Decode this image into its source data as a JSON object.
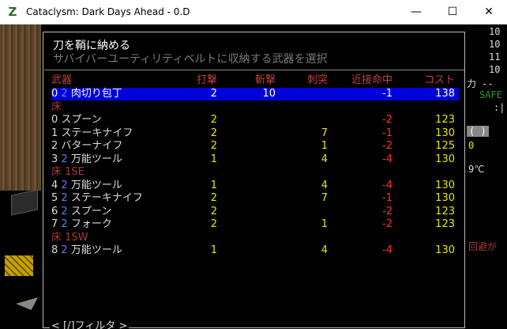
{
  "window": {
    "title": "Cataclysm: Dark Days Ahead - 0.D",
    "icon_glyph": "Z",
    "icon": "cataclysm-z-icon",
    "minimize_glyph": "—",
    "maximize_glyph": "☐",
    "close_glyph": "✕"
  },
  "dialog": {
    "title": "刀を鞘に納める",
    "subtitle": "サバイバーユーティリティベルトに収納する武器を選択",
    "headers": {
      "weapon": "武器",
      "bash": "打撃",
      "cut": "斬撃",
      "stab": "刺突",
      "to_hit": "近接命中",
      "cost": "コスト"
    },
    "rows": [
      {
        "type": "item",
        "idx": "0",
        "qty": "2",
        "name": "肉切り包丁",
        "bash": "2",
        "cut": "10",
        "stab": "",
        "hit": "-1",
        "cost": "138",
        "selected": true
      },
      {
        "type": "cat",
        "label": "床"
      },
      {
        "type": "item",
        "idx": "0",
        "qty": "",
        "name": "スプーン",
        "bash": "2",
        "cut": "",
        "stab": "",
        "hit": "-2",
        "cost": "123"
      },
      {
        "type": "item",
        "idx": "1",
        "qty": "",
        "name": "ステーキナイフ",
        "bash": "2",
        "cut": "",
        "stab": "7",
        "hit": "-1",
        "cost": "130"
      },
      {
        "type": "item",
        "idx": "2",
        "qty": "",
        "name": "バターナイフ",
        "bash": "2",
        "cut": "",
        "stab": "1",
        "hit": "-2",
        "cost": "125"
      },
      {
        "type": "item",
        "idx": "3",
        "qty": "2",
        "name": "万能ツール",
        "bash": "1",
        "cut": "",
        "stab": "4",
        "hit": "-4",
        "cost": "130"
      },
      {
        "type": "cat",
        "label": "床 1SE"
      },
      {
        "type": "item",
        "idx": "4",
        "qty": "2",
        "name": "万能ツール",
        "bash": "1",
        "cut": "",
        "stab": "4",
        "hit": "-4",
        "cost": "130"
      },
      {
        "type": "item",
        "idx": "5",
        "qty": "2",
        "name": "ステーキナイフ",
        "bash": "2",
        "cut": "",
        "stab": "7",
        "hit": "-1",
        "cost": "130"
      },
      {
        "type": "item",
        "idx": "6",
        "qty": "2",
        "name": "スプーン",
        "bash": "2",
        "cut": "",
        "stab": "",
        "hit": "-2",
        "cost": "123"
      },
      {
        "type": "item",
        "idx": "7",
        "qty": "2",
        "name": "フォーク",
        "bash": "2",
        "cut": "",
        "stab": "1",
        "hit": "-2",
        "cost": "123"
      },
      {
        "type": "cat",
        "label": "床 1SW"
      },
      {
        "type": "item",
        "idx": "8",
        "qty": "2",
        "name": "万能ツール",
        "bash": "1",
        "cut": "",
        "stab": "4",
        "hit": "-4",
        "cost": "130"
      }
    ],
    "footer": "< [/]フィルタ >"
  },
  "sidebar": {
    "lines": [
      "10",
      "10",
      "11",
      "10",
      "力 --",
      "SAFE",
      ":|",
      "(  )",
      "0",
      "9℃",
      "回避が"
    ]
  },
  "colors": {
    "selection": "#0000d8",
    "header": "#c04040",
    "category": "#a83a3a",
    "yellow": "#e6e600",
    "red": "#ff3030",
    "qty_blue": "#5a7bff"
  }
}
